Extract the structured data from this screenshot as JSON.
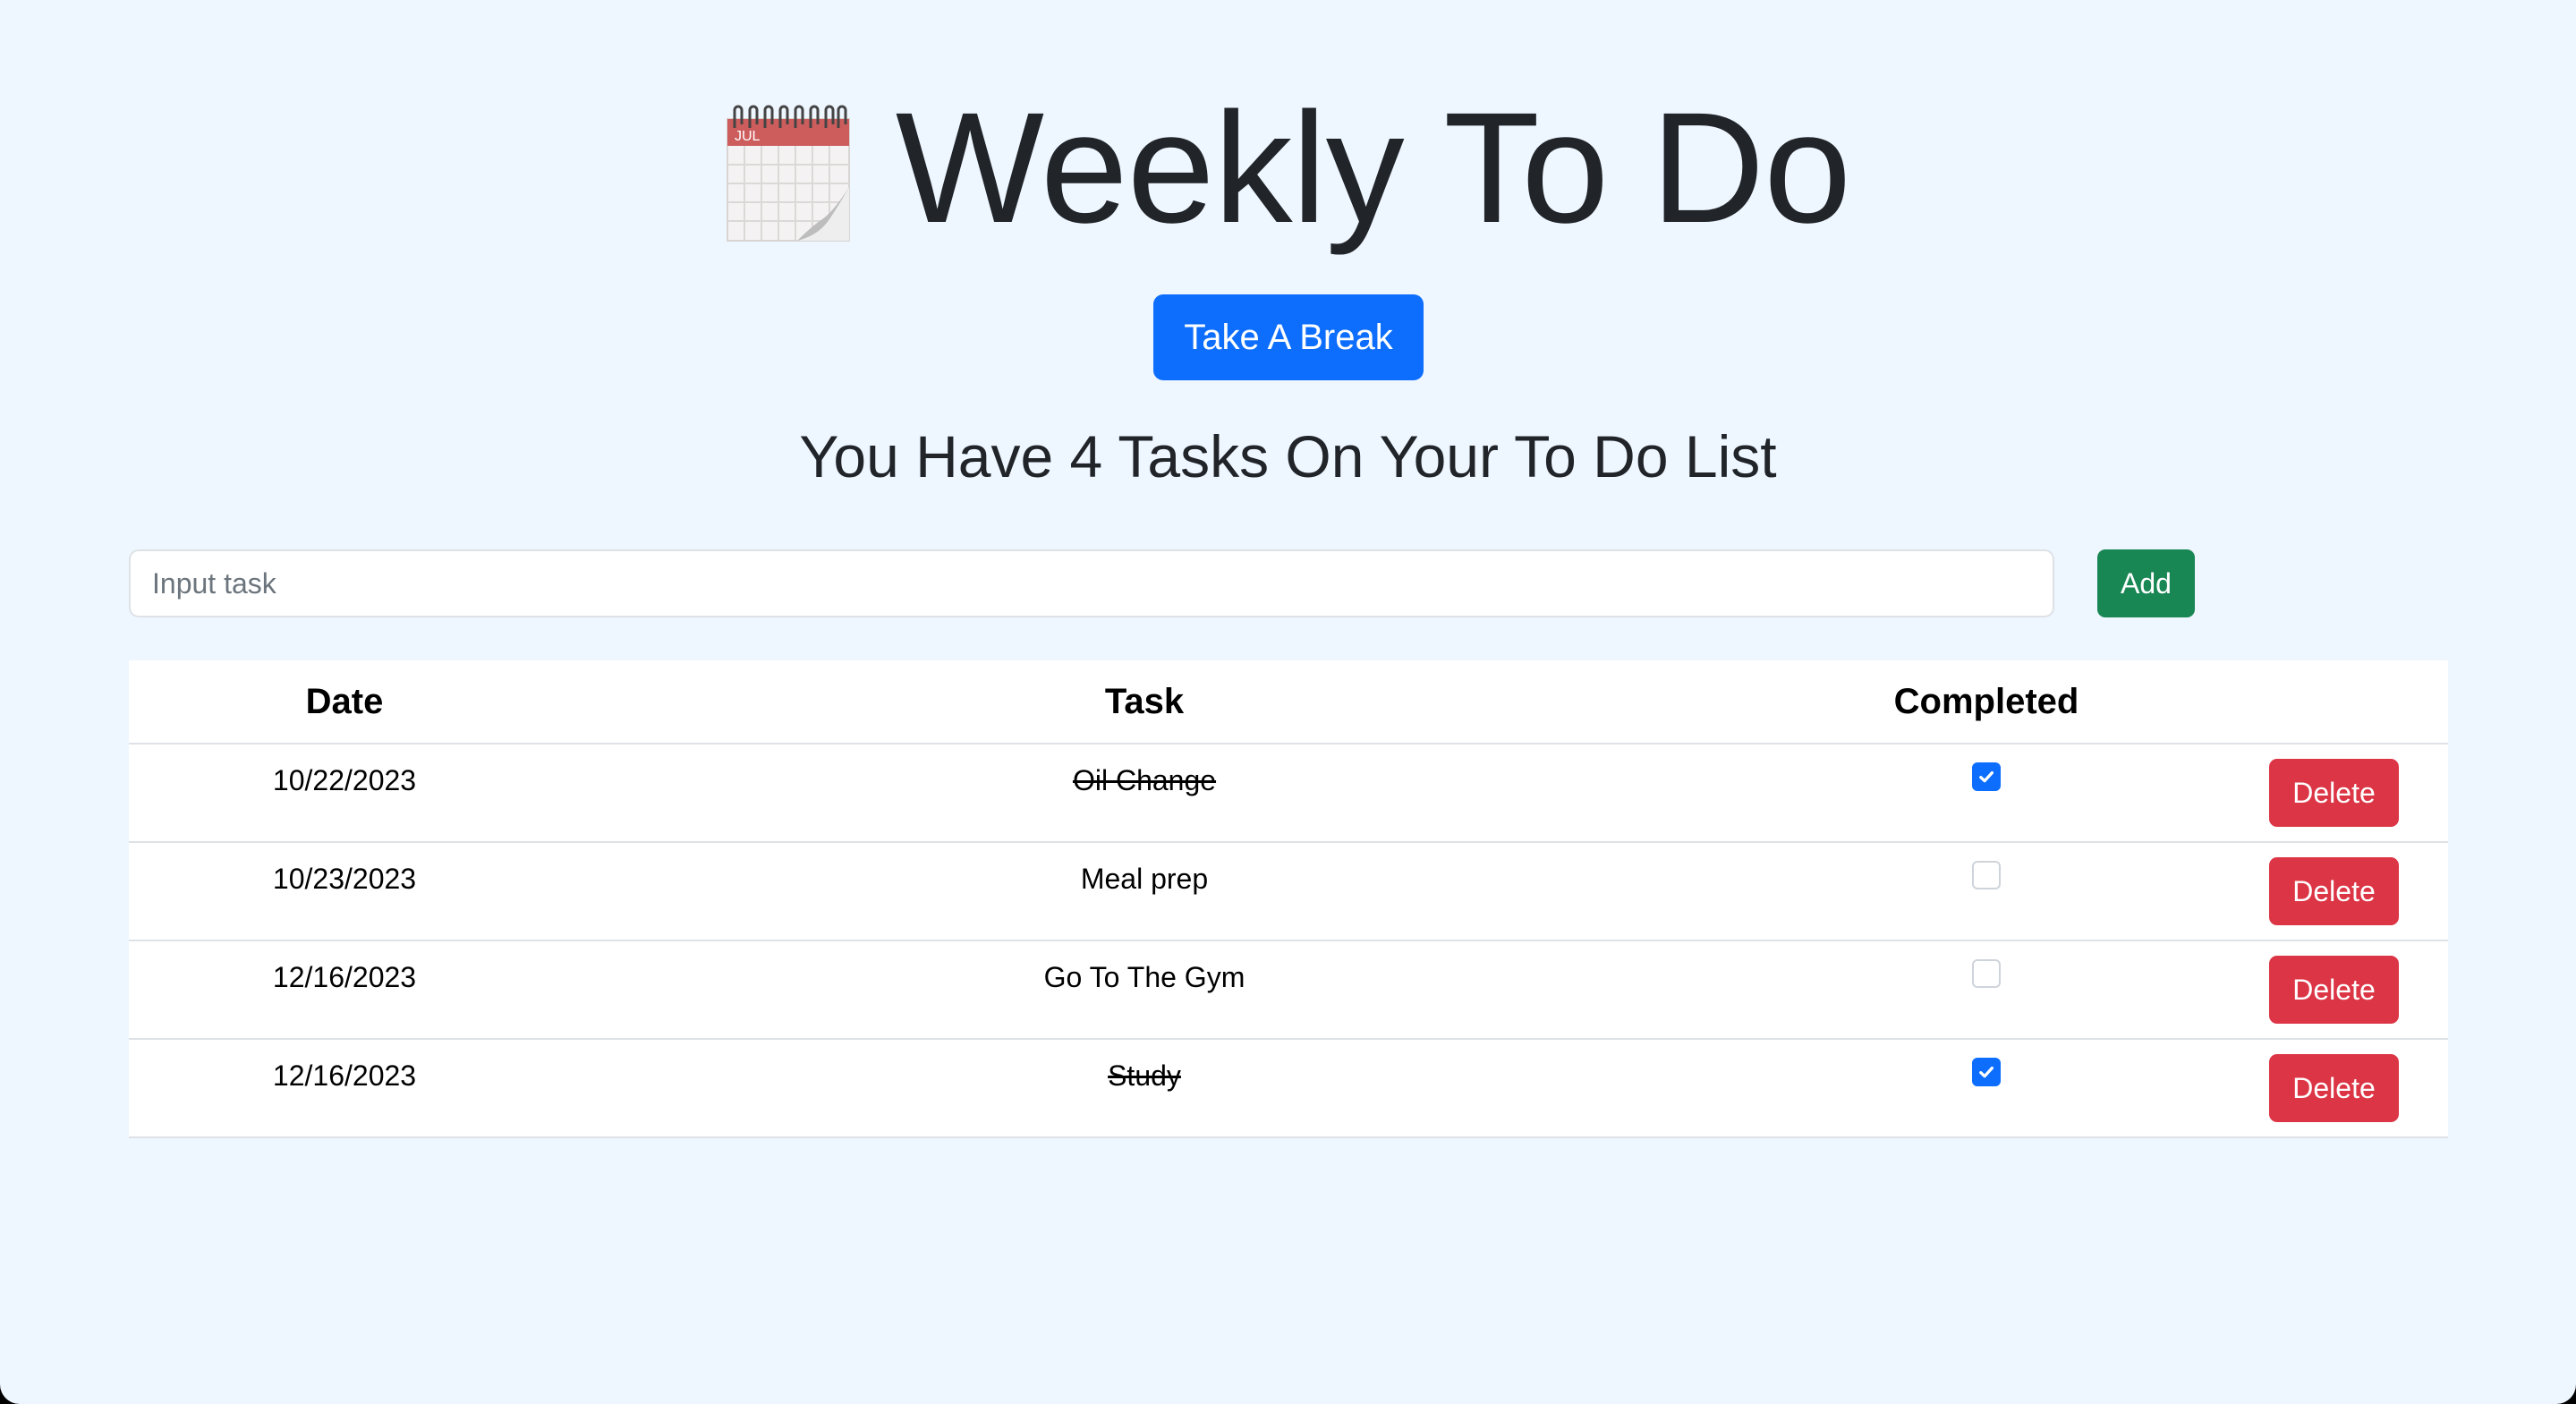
{
  "header": {
    "title": "Weekly To Do",
    "title_icon": "calendar-icon",
    "calendar_month": "JUL"
  },
  "break_button": {
    "label": "Take A Break"
  },
  "summary": {
    "text": "You Have 4 Tasks On Your To Do List"
  },
  "new_task": {
    "placeholder": "Input task",
    "value": "",
    "add_label": "Add"
  },
  "table": {
    "columns": [
      "Date",
      "Task",
      "Completed"
    ],
    "delete_label": "Delete",
    "rows": [
      {
        "date": "10/22/2023",
        "task": "Oil Change",
        "completed": true
      },
      {
        "date": "10/23/2023",
        "task": "Meal prep",
        "completed": false
      },
      {
        "date": "12/16/2023",
        "task": "Go To The Gym",
        "completed": false
      },
      {
        "date": "12/16/2023",
        "task": "Study",
        "completed": true
      }
    ]
  },
  "colors": {
    "background": "#eef6ff",
    "primary": "#0d6efd",
    "success": "#198754",
    "danger": "#dc3545",
    "calendar_red": "#d9534f"
  }
}
